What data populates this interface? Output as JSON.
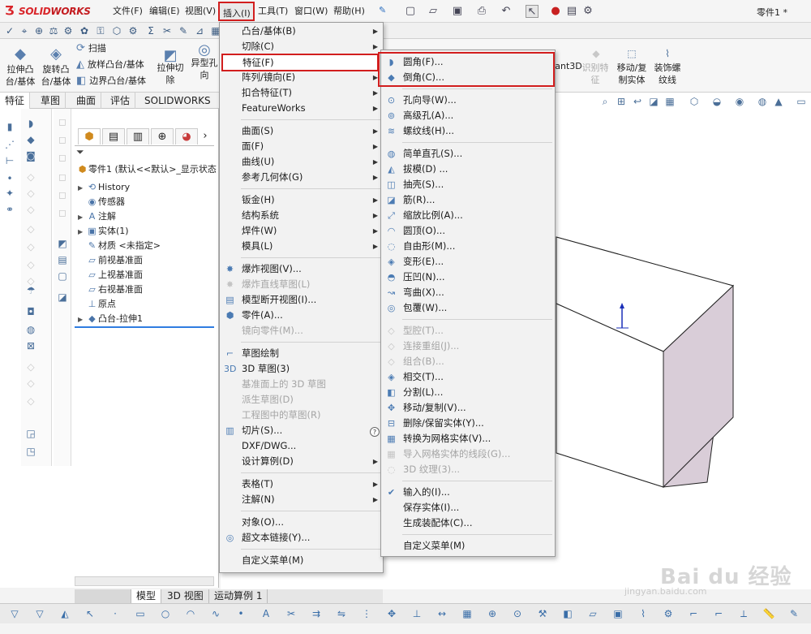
{
  "app": {
    "logo_ds": "3S",
    "logo_name_a": "SOLID",
    "logo_name_b": "WORKS",
    "doc_title": "零件1 *"
  },
  "menubar": [
    {
      "label": "文件(F)"
    },
    {
      "label": "编辑(E)"
    },
    {
      "label": "视图(V)"
    },
    {
      "label": "插入(I)"
    },
    {
      "label": "工具(T)"
    },
    {
      "label": "窗口(W)"
    },
    {
      "label": "帮助(H)"
    }
  ],
  "commands": {
    "extrude_boss": "拉伸凸\n台/基体",
    "revolve_boss": "旋转凸\n台/基体",
    "sweep": "扫描",
    "loft": "放样凸台/基体",
    "boundary": "边界凸台/基体",
    "extrude_cut": "拉伸切\n除",
    "hole_wizard": "异型孔向",
    "rib": "筋",
    "wrap": "包覆",
    "instant3d": "Instant3D",
    "recognize": "识别特\n征",
    "move_copy": "移动/复\n制实体",
    "cosmetic_thread": "装饰螺\n纹线"
  },
  "tabs": [
    "特征",
    "草图",
    "曲面",
    "评估",
    "SOLIDWORKS 插件"
  ],
  "tree": {
    "root": "零件1  (默认<<默认>_显示状态",
    "items": [
      {
        "label": "History",
        "icon": "history-icon",
        "expand": true
      },
      {
        "label": "传感器",
        "icon": "sensor-icon",
        "expand": false
      },
      {
        "label": "注解",
        "icon": "annotation-icon",
        "expand": true
      },
      {
        "label": "实体(1)",
        "icon": "solid-bodies-icon",
        "expand": true
      },
      {
        "label": "材质 <未指定>",
        "icon": "material-icon",
        "expand": false
      },
      {
        "label": "前视基准面",
        "icon": "plane-icon",
        "expand": false
      },
      {
        "label": "上视基准面",
        "icon": "plane-icon",
        "expand": false
      },
      {
        "label": "右视基准面",
        "icon": "plane-icon",
        "expand": false
      },
      {
        "label": "原点",
        "icon": "origin-icon",
        "expand": false
      },
      {
        "label": "凸台-拉伸1",
        "icon": "extrude-icon",
        "expand": true
      }
    ]
  },
  "bottom_tabs": [
    "模型",
    "3D 视图",
    "运动算例 1"
  ],
  "insert_menu": {
    "items": [
      {
        "label": "凸台/基体(B)",
        "sub": true,
        "disabled": false,
        "icon": ""
      },
      {
        "label": "切除(C)",
        "sub": true,
        "disabled": false,
        "icon": ""
      },
      {
        "label": "特征(F)",
        "sub": true,
        "disabled": false,
        "icon": "",
        "selected": true
      },
      {
        "label": "阵列/镜向(E)",
        "sub": true,
        "disabled": false,
        "icon": ""
      },
      {
        "label": "扣合特征(T)",
        "sub": true,
        "disabled": false,
        "icon": ""
      },
      {
        "label": "FeatureWorks",
        "sub": true,
        "disabled": false,
        "icon": ""
      },
      {
        "sep": true
      },
      {
        "label": "曲面(S)",
        "sub": true,
        "disabled": false,
        "icon": ""
      },
      {
        "label": "面(F)",
        "sub": true,
        "disabled": false,
        "icon": ""
      },
      {
        "label": "曲线(U)",
        "sub": true,
        "disabled": false,
        "icon": ""
      },
      {
        "label": "参考几何体(G)",
        "sub": true,
        "disabled": false,
        "icon": ""
      },
      {
        "sep": true
      },
      {
        "label": "钣金(H)",
        "sub": true,
        "disabled": false,
        "icon": ""
      },
      {
        "label": "结构系统",
        "sub": true,
        "disabled": false,
        "icon": ""
      },
      {
        "label": "焊件(W)",
        "sub": true,
        "disabled": false,
        "icon": ""
      },
      {
        "label": "模具(L)",
        "sub": true,
        "disabled": false,
        "icon": ""
      },
      {
        "sep": true
      },
      {
        "label": "爆炸视图(V)...",
        "sub": false,
        "disabled": false,
        "icon": "explode-icon"
      },
      {
        "label": "爆炸直线草图(L)",
        "sub": false,
        "disabled": true,
        "icon": "explode-line-icon"
      },
      {
        "label": "模型断开视图(I)...",
        "sub": false,
        "disabled": false,
        "icon": "break-view-icon"
      },
      {
        "label": "零件(A)...",
        "sub": false,
        "disabled": false,
        "icon": "part-icon"
      },
      {
        "label": "镜向零件(M)...",
        "sub": false,
        "disabled": true,
        "icon": ""
      },
      {
        "sep": true
      },
      {
        "label": "草图绘制",
        "sub": false,
        "disabled": false,
        "icon": "sketch-icon"
      },
      {
        "label": "3D 草图(3)",
        "sub": false,
        "disabled": false,
        "icon": "3d-sketch-icon"
      },
      {
        "label": "基准面上的 3D 草图",
        "sub": false,
        "disabled": true,
        "icon": ""
      },
      {
        "label": "派生草图(D)",
        "sub": false,
        "disabled": true,
        "icon": ""
      },
      {
        "label": "工程图中的草图(R)",
        "sub": false,
        "disabled": true,
        "icon": ""
      },
      {
        "label": "切片(S)...",
        "sub": false,
        "disabled": false,
        "icon": "slice-icon"
      },
      {
        "label": "DXF/DWG...",
        "sub": false,
        "disabled": false,
        "icon": ""
      },
      {
        "label": "设计算例(D)",
        "sub": true,
        "disabled": false,
        "icon": ""
      },
      {
        "sep": true
      },
      {
        "label": "表格(T)",
        "sub": true,
        "disabled": false,
        "icon": ""
      },
      {
        "label": "注解(N)",
        "sub": true,
        "disabled": false,
        "icon": ""
      },
      {
        "sep": true
      },
      {
        "label": "对象(O)...",
        "sub": false,
        "disabled": false,
        "icon": ""
      },
      {
        "label": "超文本链接(Y)...",
        "sub": false,
        "disabled": false,
        "icon": "hyperlink-icon"
      },
      {
        "sep": true
      },
      {
        "label": "自定义菜单(M)",
        "sub": false,
        "disabled": false,
        "icon": ""
      }
    ]
  },
  "feature_menu": {
    "items": [
      {
        "label": "圆角(F)...",
        "disabled": false,
        "icon": "fillet-icon"
      },
      {
        "label": "倒角(C)...",
        "disabled": false,
        "icon": "chamfer-icon"
      },
      {
        "sep": true
      },
      {
        "label": "孔向导(W)...",
        "disabled": false,
        "icon": "hole-wizard-icon"
      },
      {
        "label": "高级孔(A)...",
        "disabled": false,
        "icon": "advanced-hole-icon"
      },
      {
        "label": "螺纹线(H)...",
        "disabled": false,
        "icon": "thread-icon"
      },
      {
        "sep": true
      },
      {
        "label": "简单直孔(S)...",
        "disabled": false,
        "icon": "simple-hole-icon"
      },
      {
        "label": "拔模(D) ...",
        "disabled": false,
        "icon": "draft-icon"
      },
      {
        "label": "抽壳(S)...",
        "disabled": false,
        "icon": "shell-icon"
      },
      {
        "label": "筋(R)...",
        "disabled": false,
        "icon": "rib-icon"
      },
      {
        "label": "缩放比例(A)...",
        "disabled": false,
        "icon": "scale-icon"
      },
      {
        "label": "圆顶(O)...",
        "disabled": false,
        "icon": "dome-icon"
      },
      {
        "label": "自由形(M)...",
        "disabled": false,
        "icon": "freeform-icon"
      },
      {
        "label": "变形(E)...",
        "disabled": false,
        "icon": "deform-icon"
      },
      {
        "label": "压凹(N)...",
        "disabled": false,
        "icon": "indent-icon"
      },
      {
        "label": "弯曲(X)...",
        "disabled": false,
        "icon": "flex-icon"
      },
      {
        "label": "包覆(W)...",
        "disabled": false,
        "icon": "wrap-icon"
      },
      {
        "sep": true
      },
      {
        "label": "型腔(T)...",
        "disabled": true,
        "icon": "cavity-icon"
      },
      {
        "label": "连接重组(J)...",
        "disabled": true,
        "icon": "join-icon"
      },
      {
        "label": "组合(B)...",
        "disabled": true,
        "icon": "combine-icon"
      },
      {
        "label": "相交(T)...",
        "disabled": false,
        "icon": "intersect-icon"
      },
      {
        "label": "分割(L)...",
        "disabled": false,
        "icon": "split-icon"
      },
      {
        "label": "移动/复制(V)...",
        "disabled": false,
        "icon": "move-copy-icon"
      },
      {
        "label": "删除/保留实体(Y)...",
        "disabled": false,
        "icon": "delete-body-icon"
      },
      {
        "label": "转换为网格实体(V)...",
        "disabled": false,
        "icon": "mesh-convert-icon"
      },
      {
        "label": "导入网格实体的线段(G)...",
        "disabled": true,
        "icon": "mesh-segment-icon"
      },
      {
        "label": "3D 纹理(3)...",
        "disabled": true,
        "icon": "3d-texture-icon"
      },
      {
        "sep": true
      },
      {
        "label": "输入的(I)...",
        "disabled": false,
        "icon": "imported-icon"
      },
      {
        "label": "保存实体(I)...",
        "disabled": false,
        "icon": ""
      },
      {
        "label": "生成装配体(C)...",
        "disabled": false,
        "icon": ""
      },
      {
        "sep": true
      },
      {
        "label": "自定义菜单(M)",
        "disabled": false,
        "icon": ""
      }
    ]
  },
  "watermark": {
    "text": "Bai du 经验",
    "url": "jingyan.baidu.com"
  },
  "colors": {
    "highlight_red": "#d21e1e",
    "box_side": "#d9cdd8",
    "box_front": "#ffffff",
    "solidworks_red": "#d9252a"
  }
}
